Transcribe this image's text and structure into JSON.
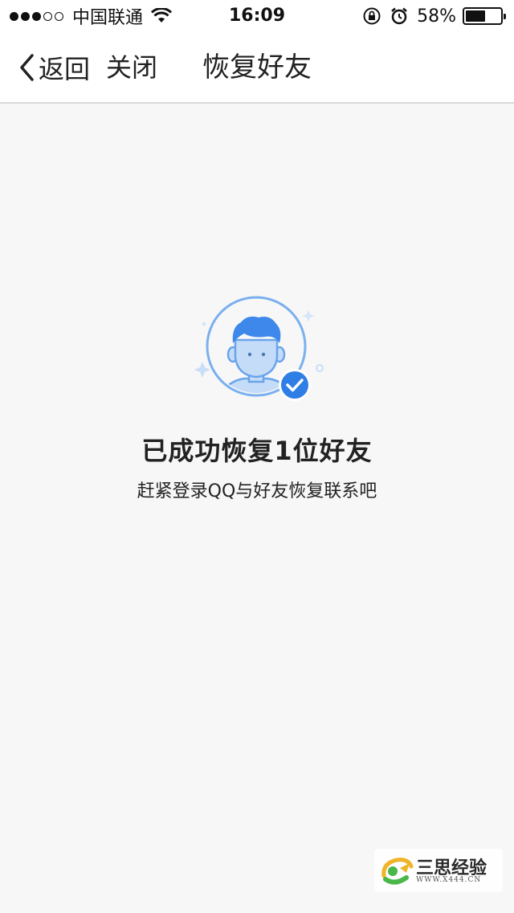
{
  "status_bar": {
    "carrier": "中国联通",
    "time": "16:09",
    "battery_percent": "58%",
    "battery_level": 0.58,
    "signal_bars_filled": 3,
    "signal_bars_total": 5,
    "icons": [
      "wifi-icon",
      "rotation-lock-icon",
      "alarm-icon",
      "battery-icon"
    ]
  },
  "nav": {
    "back_label": "返回",
    "close_label": "关闭",
    "title": "恢复好友"
  },
  "result": {
    "title": "已成功恢复1位好友",
    "subtitle": "赶紧登录QQ与好友恢复联系吧",
    "icon": "user-restored-check-icon"
  },
  "watermark": {
    "name": "三思经验",
    "url": "WWW.X444.CN"
  },
  "colors": {
    "accent_blue": "#2f7ee6",
    "avatar_light": "#c5dcf8",
    "background": "#f7f7f7"
  }
}
